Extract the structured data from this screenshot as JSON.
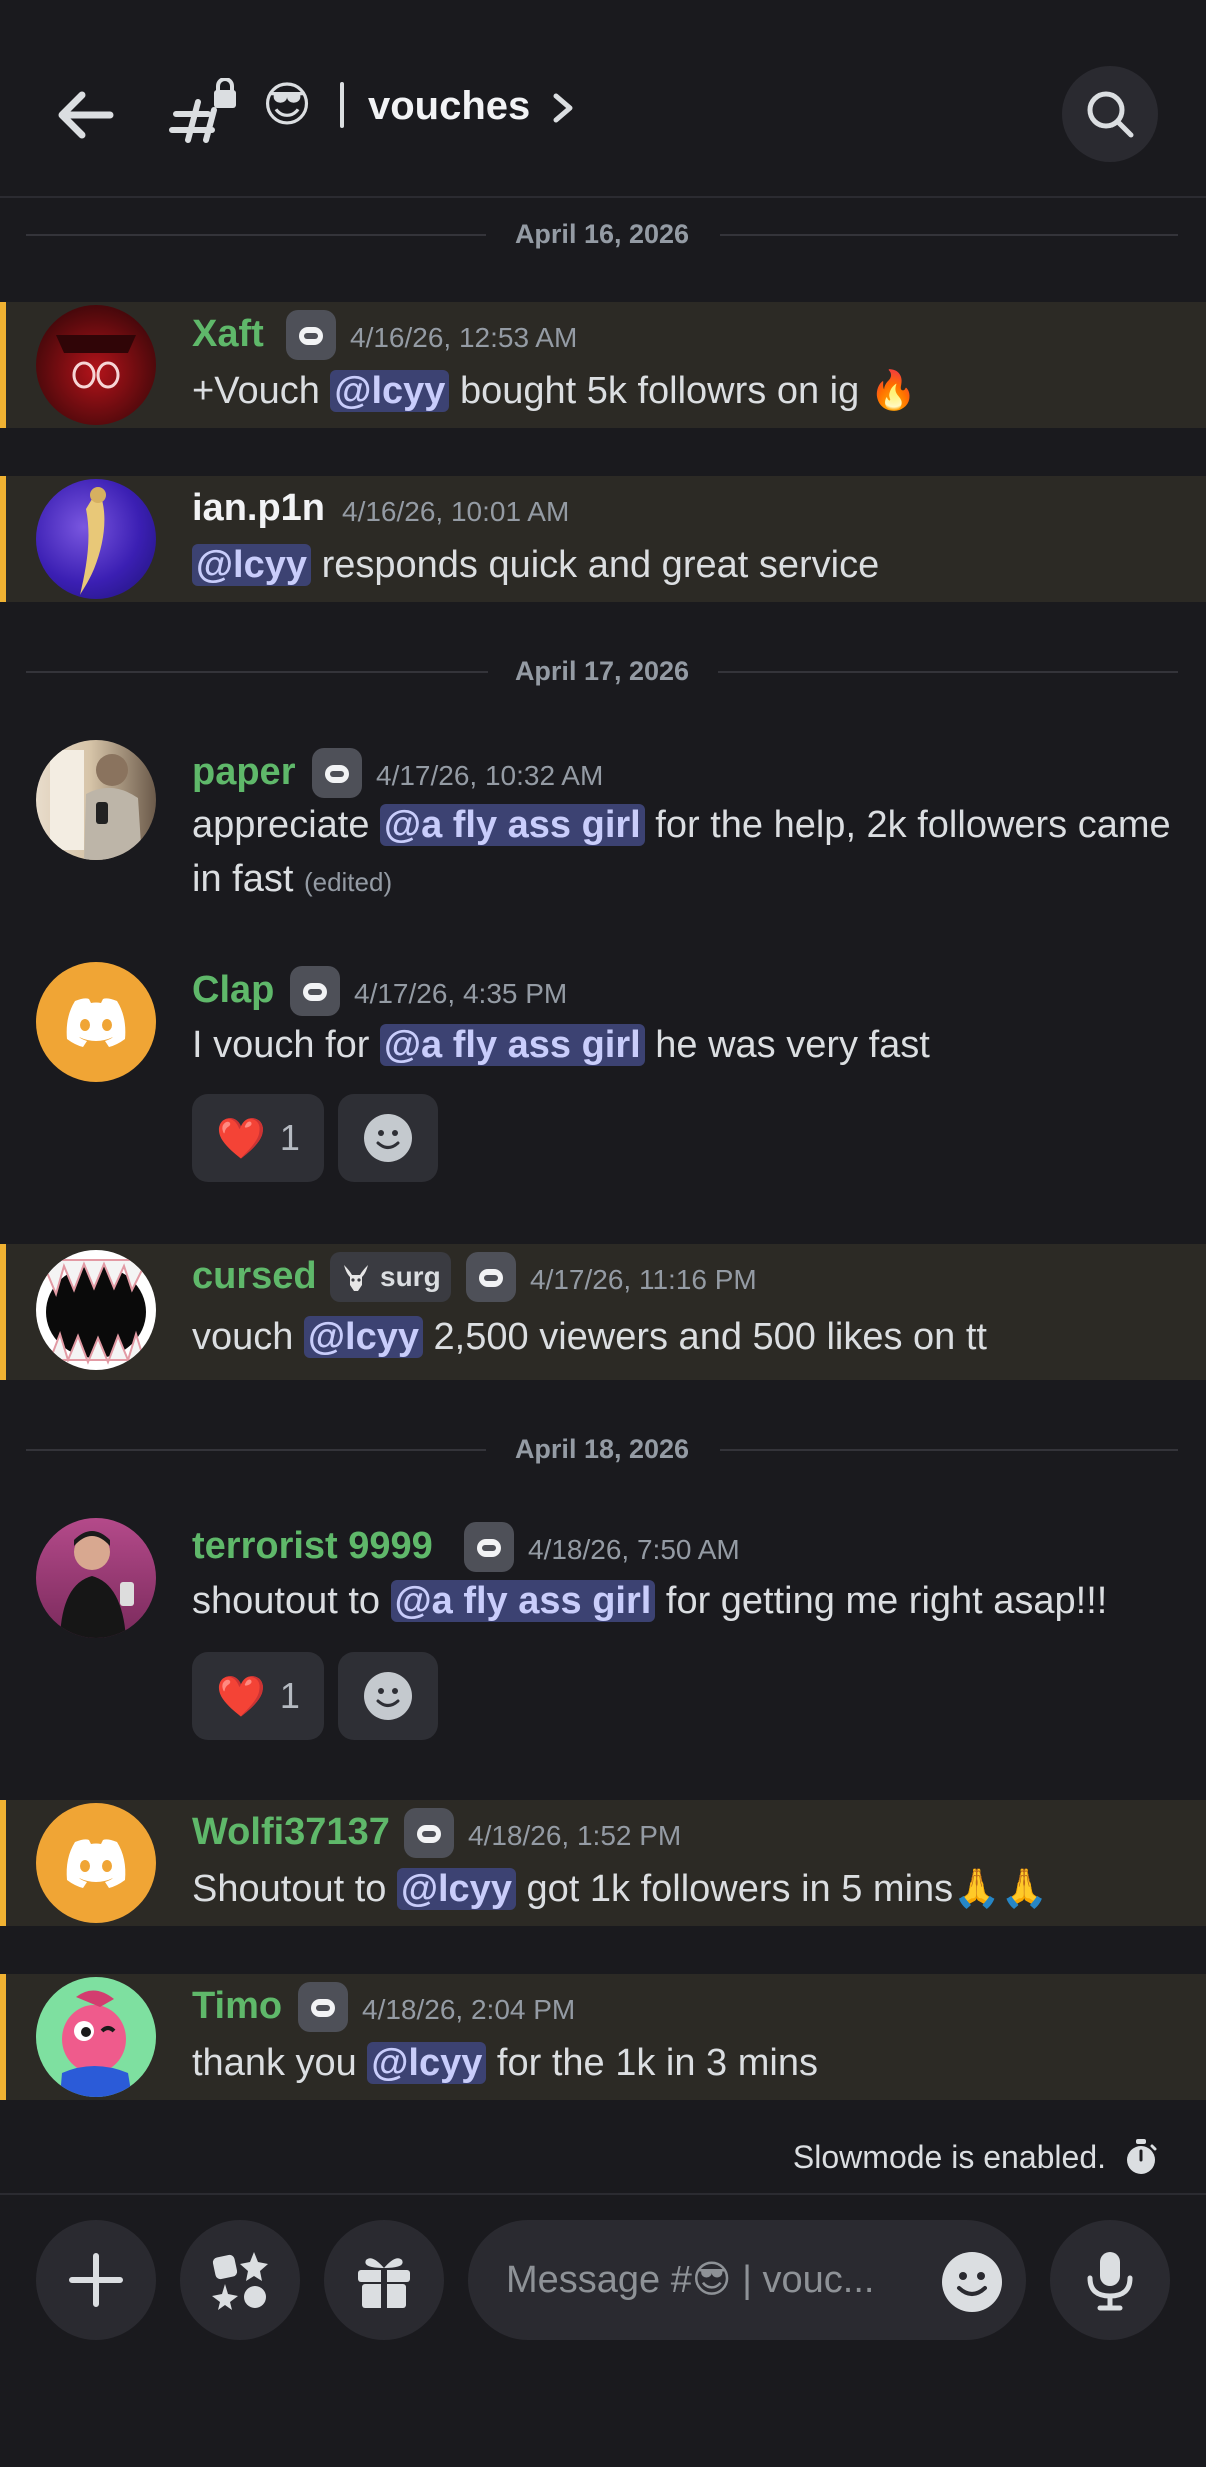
{
  "header": {
    "channel_emoji": "😎",
    "channel_name": "vouches"
  },
  "dates": [
    "April 16, 2026",
    "April 17, 2026",
    "April 18, 2026"
  ],
  "messages": [
    {
      "username": "Xaft",
      "timestamp": "4/16/26, 12:53 AM",
      "text_before": "+Vouch ",
      "mention": "@lcyy",
      "text_after": " bought 5k followrs on ig ",
      "emoji": "🔥"
    },
    {
      "username": "ian.p1n",
      "timestamp": "4/16/26, 10:01 AM",
      "text_before": "",
      "mention": "@lcyy",
      "text_after": " responds quick and great service"
    },
    {
      "username": "paper",
      "timestamp": "4/17/26, 10:32 AM",
      "text_before": "appreciate ",
      "mention": "@a fly ass girl",
      "text_after": " for the help, 2k followers came in fast ",
      "edited": "(edited)"
    },
    {
      "username": "Clap",
      "timestamp": "4/17/26, 4:35 PM",
      "text_before": "I vouch for ",
      "mention": "@a fly ass girl",
      "text_after": " he was very fast",
      "reaction_emoji": "❤️",
      "reaction_count": "1"
    },
    {
      "username": "cursed",
      "tag": "surg",
      "timestamp": "4/17/26, 11:16 PM",
      "text_before": "vouch ",
      "mention": "@lcyy",
      "text_after": " 2,500 viewers and 500 likes on tt"
    },
    {
      "username": "terrorist 9999",
      "timestamp": "4/18/26, 7:50 AM",
      "text_before": "shoutout to ",
      "mention": "@a fly ass girl",
      "text_after": " for getting me right asap!!!",
      "reaction_emoji": "❤️",
      "reaction_count": "1"
    },
    {
      "username": "Wolfi37137",
      "timestamp": "4/18/26, 1:52 PM",
      "text_before": "Shoutout to ",
      "mention": "@lcyy",
      "text_after": " got 1k followers in 5 mins",
      "emoji": "🙏🙏"
    },
    {
      "username": "Timo",
      "timestamp": "4/18/26, 2:04 PM",
      "text_before": "thank you ",
      "mention": "@lcyy",
      "text_after": " for the 1k in 3 mins"
    }
  ],
  "slowmode_text": "Slowmode is enabled.",
  "composer": {
    "placeholder_prefix": "Message #",
    "placeholder_emoji": "😎",
    "placeholder_suffix": " | vouc..."
  },
  "colors": {
    "background": "#1a1a1e",
    "highlight_bg": "#2c2a25",
    "highlight_bar": "#f0b232",
    "username_green": "#5fb86a",
    "mention_bg": "#3c4272",
    "discord_orange": "#f0a535"
  },
  "icons": {
    "back": "arrow-left-icon",
    "channel": "locked-hash-icon",
    "search": "search-icon",
    "plus": "plus-icon",
    "apps": "apps-icon",
    "gift": "gift-icon",
    "emoji": "smiley-icon",
    "mic": "microphone-icon",
    "timer": "stopwatch-icon",
    "bot": "bot-badge-icon"
  }
}
